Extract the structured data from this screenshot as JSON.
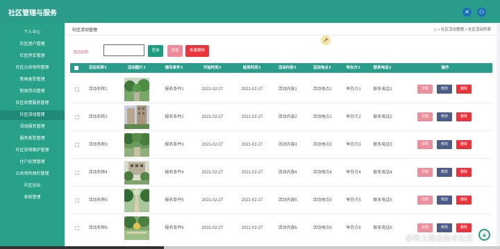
{
  "app": {
    "title": "社区管理与服务"
  },
  "topbar": {
    "icons": [
      "expand-icon",
      "user-icon"
    ],
    "expand_glyph": "✕",
    "user_glyph": "⚇"
  },
  "sidebar": {
    "items": [
      {
        "label": "个人中心"
      },
      {
        "label": "社区用户管理"
      },
      {
        "label": "社区停车管理"
      },
      {
        "label": "社区公共场所管理"
      },
      {
        "label": "新闻类型管理"
      },
      {
        "label": "新闻资讯管理"
      },
      {
        "label": "社区收费服务管理"
      },
      {
        "label": "社区活动管理"
      },
      {
        "label": "活动报名管理"
      },
      {
        "label": "服务类型管理"
      },
      {
        "label": "社区安保维护管理"
      },
      {
        "label": "住户反馈管理"
      },
      {
        "label": "公共场所预约管理"
      },
      {
        "label": "社区论坛"
      },
      {
        "label": "系统管理"
      }
    ]
  },
  "breadcrumb": {
    "page_title": "社区活动管理",
    "home_glyph": "⌂",
    "path": "» 社区活动管理 » 社区活动列表"
  },
  "search": {
    "label": "活动名称",
    "value": "",
    "placeholder": "",
    "search_label": "查询",
    "add_label": "添加",
    "batch_delete_label": "批量删除"
  },
  "table": {
    "headers": [
      "活动名称",
      "活动图片",
      "报名条件",
      "开始时间",
      "结束时间",
      "活动内容",
      "活动地点",
      "举办方",
      "联系电话",
      "操作"
    ],
    "actions": {
      "detail": "详情",
      "edit": "修改",
      "delete": "删除"
    },
    "rows": [
      {
        "name": "活动名称1",
        "condition": "报名条件1",
        "start": "2021-02-27",
        "end": "2021-02-27",
        "content": "活动内容1",
        "location": "活动地点1",
        "organizer": "举办方1",
        "phone": "联系电话1"
      },
      {
        "name": "活动名称2",
        "condition": "报名条件2",
        "start": "2021-02-27",
        "end": "2021-02-27",
        "content": "活动内容2",
        "location": "活动地点2",
        "organizer": "举办方2",
        "phone": "联系电话2"
      },
      {
        "name": "活动名称3",
        "condition": "报名条件3",
        "start": "2021-02-27",
        "end": "2021-02-27",
        "content": "活动内容3",
        "location": "活动地点3",
        "organizer": "举办方3",
        "phone": "联系电话3"
      },
      {
        "name": "活动名称4",
        "condition": "报名条件4",
        "start": "2021-02-27",
        "end": "2021-02-27",
        "content": "活动内容4",
        "location": "活动地点4",
        "organizer": "举办方4",
        "phone": "联系电话4"
      },
      {
        "name": "活动名称5",
        "condition": "报名条件5",
        "start": "2021-02-27",
        "end": "2021-02-27",
        "content": "活动内容5",
        "location": "活动地点5",
        "organizer": "举办方5",
        "phone": "联系电话5"
      },
      {
        "name": "活动名称6",
        "condition": "报名条件6",
        "start": "2021-02-27",
        "end": "2021-02-27",
        "content": "活动内容6",
        "location": "活动地点6",
        "organizer": "举办方6",
        "phone": "联系电话6"
      }
    ]
  },
  "watermark": {
    "text": "@稀土掘金技术社区"
  },
  "colors": {
    "primary": "#2a9d8a",
    "sidebar": "#28a189",
    "danger": "#e8353d",
    "pink": "#ec8f9b",
    "navy": "#4d5c86"
  }
}
